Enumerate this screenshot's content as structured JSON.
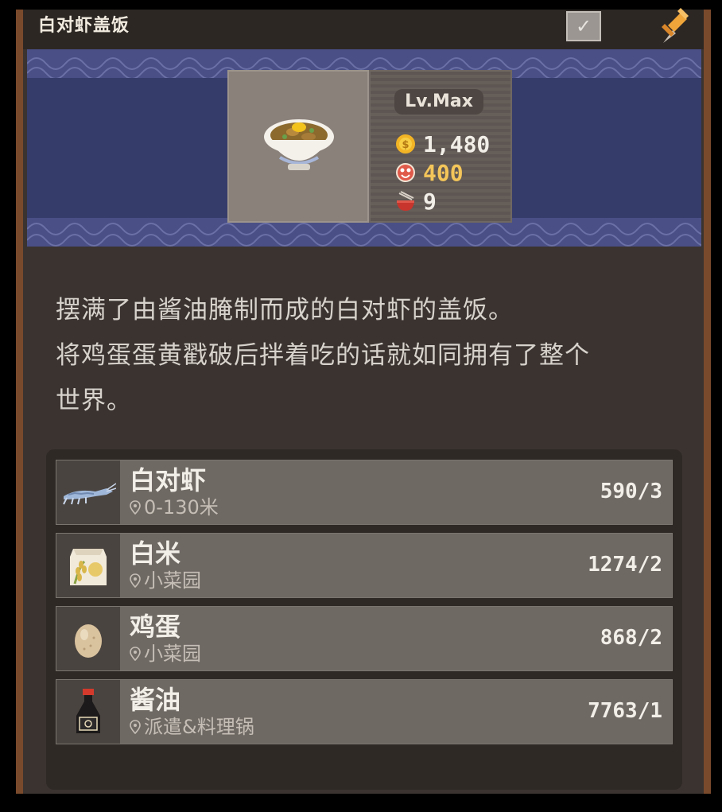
{
  "window": {
    "title": "白对虾盖饭",
    "checkbox_mark": "✓"
  },
  "dish": {
    "level": "Lv.Max",
    "stats": [
      {
        "icon": "coin-icon",
        "value": "1,480",
        "color": "#f2eee8"
      },
      {
        "icon": "taste-icon",
        "value": "400",
        "color": "#f4c65a"
      },
      {
        "icon": "bowl-icon",
        "value": "9",
        "color": "#f2eee8"
      }
    ]
  },
  "description": {
    "line1": "摆满了由酱油腌制而成的白对虾的盖饭。",
    "line2": "将鸡蛋蛋黄戳破后拌着吃的话就如同拥有了整个",
    "line3": "世界。"
  },
  "ingredients": [
    {
      "icon": "shrimp-icon",
      "name": "白对虾",
      "location": "0-130米",
      "count": "590/3"
    },
    {
      "icon": "rice-bag-icon",
      "name": "白米",
      "location": "小菜园",
      "count": "1274/2"
    },
    {
      "icon": "egg-icon",
      "name": "鸡蛋",
      "location": "小菜园",
      "count": "868/2"
    },
    {
      "icon": "soy-sauce-icon",
      "name": "酱油",
      "location": "派遣&料理锅",
      "count": "7763/1"
    }
  ],
  "colors": {
    "banner": "#363c6a",
    "panel": "#3a3330",
    "frame_border": "#7a4a2c",
    "gold_value": "#f4c65a"
  }
}
